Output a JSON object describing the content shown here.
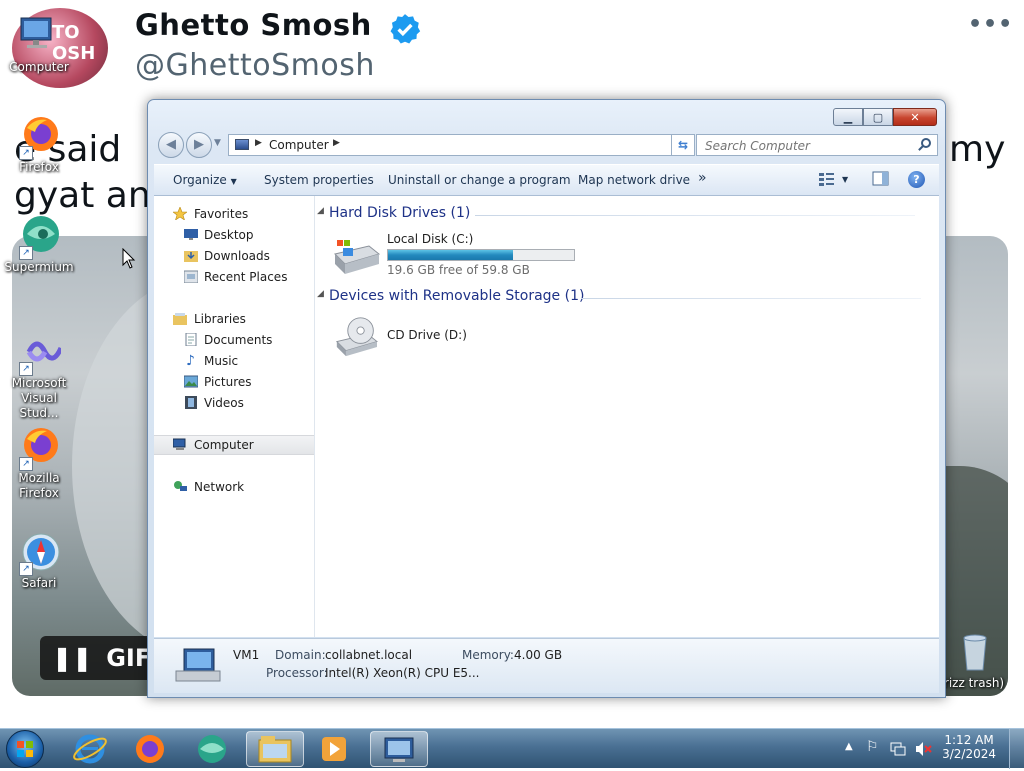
{
  "tweet": {
    "name": "Ghetto Smosh",
    "handle": "@GhettoSmosh",
    "avatar_text": "TO OSH",
    "text_line1": "e said",
    "text_line2": "gyat an",
    "text_tail": "my",
    "gif_label": "GIF",
    "verified_color": "#1d9bf0"
  },
  "desktop_icons": [
    {
      "label": "Computer",
      "icon": "computer-icon"
    },
    {
      "label": "Firefox",
      "icon": "firefox-icon"
    },
    {
      "label": "Supermium",
      "icon": "supermium-icon"
    },
    {
      "label": "Microsoft Visual Stud...",
      "icon": "visual-studio-icon"
    },
    {
      "label": "Mozilla Firefox",
      "icon": "firefox-icon"
    },
    {
      "label": "Safari",
      "icon": "safari-icon"
    },
    {
      "label": "rizz trash)",
      "icon": "recycle-bin-icon"
    }
  ],
  "explorer": {
    "address": {
      "location": "Computer"
    },
    "search": {
      "placeholder": "Search Computer"
    },
    "toolbar": {
      "organize": "Organize",
      "system_properties": "System properties",
      "uninstall": "Uninstall or change a program",
      "map_drive": "Map network drive",
      "more": "»"
    },
    "nav": {
      "favorites": "Favorites",
      "desktop": "Desktop",
      "downloads": "Downloads",
      "recent": "Recent Places",
      "libraries": "Libraries",
      "documents": "Documents",
      "music": "Music",
      "pictures": "Pictures",
      "videos": "Videos",
      "computer": "Computer",
      "network": "Network"
    },
    "groups": {
      "hdd": "Hard Disk Drives (1)",
      "removable": "Devices with Removable Storage (1)"
    },
    "drives": {
      "c_name": "Local Disk (C:)",
      "c_free": "19.6 GB free of 59.8 GB",
      "c_used_fraction": 0.672,
      "d_name": "CD Drive (D:)"
    },
    "details": {
      "computer_name": "VM1",
      "domain_label": "Domain:",
      "domain": "collabnet.local",
      "memory_label": "Memory:",
      "memory": "4.00 GB",
      "processor_label": "Processor:",
      "processor": "Intel(R) Xeon(R) CPU E5..."
    }
  },
  "taskbar": {
    "time": "1:12 AM",
    "date": "3/2/2024",
    "pinned": [
      "internet-explorer-icon",
      "firefox-icon",
      "supermium-icon",
      "explorer-icon",
      "media-player-icon",
      "control-panel-icon"
    ],
    "tray": [
      "show-hidden-icon",
      "action-center-flag-icon",
      "network-icon",
      "volume-muted-icon"
    ]
  }
}
